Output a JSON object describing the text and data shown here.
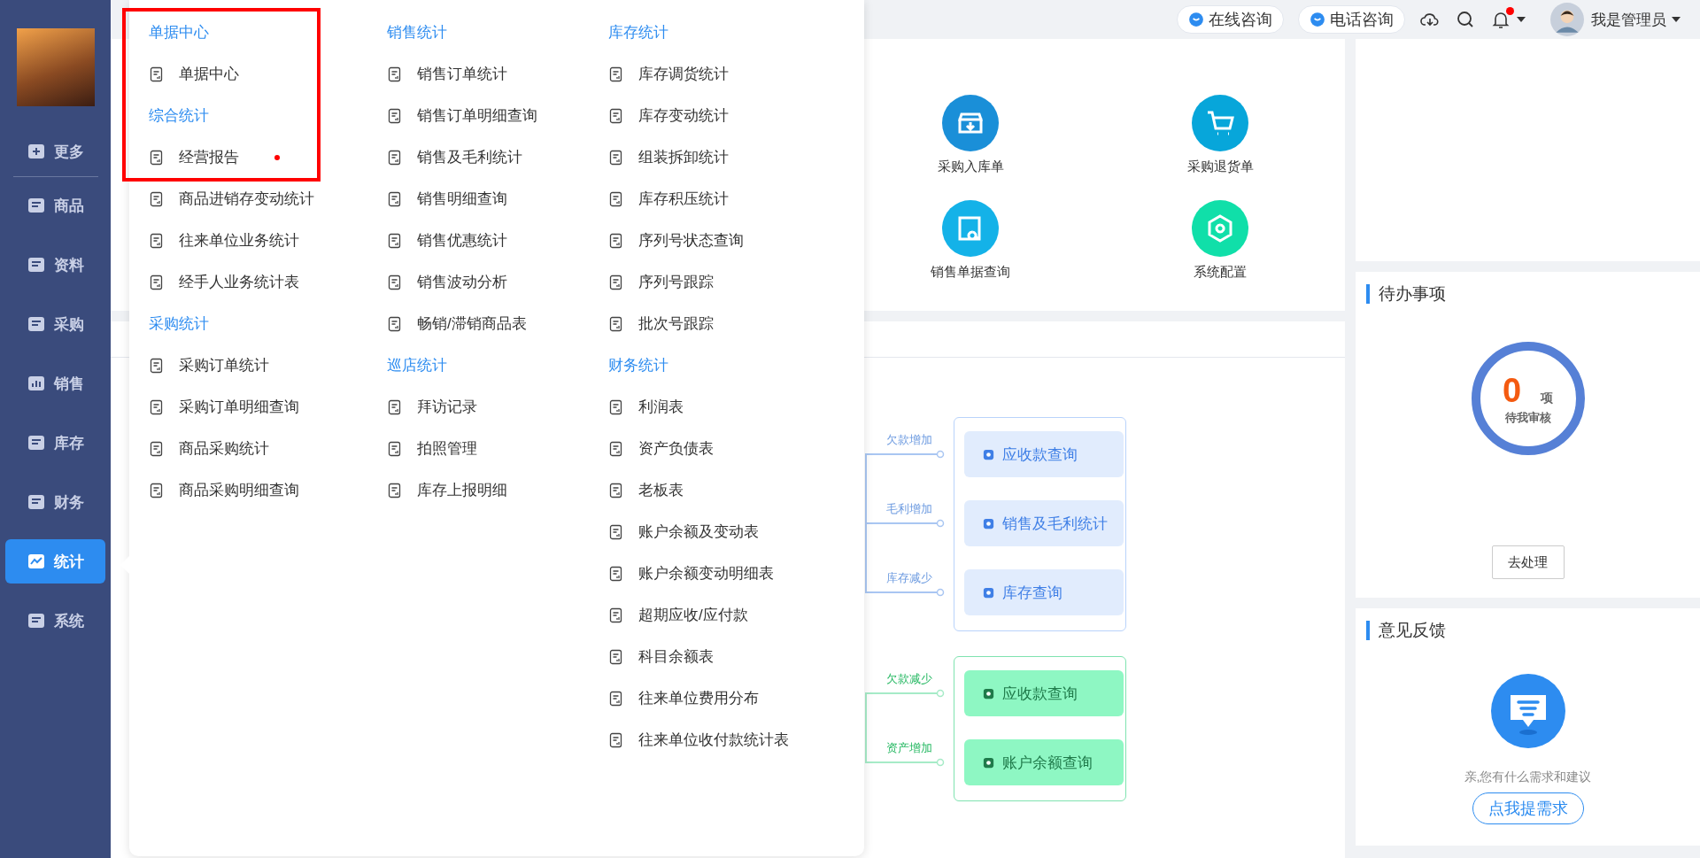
{
  "sidebar": {
    "items": [
      {
        "label": "更多",
        "selected": false
      },
      {
        "label": "商品",
        "selected": false
      },
      {
        "label": "资料",
        "selected": false
      },
      {
        "label": "采购",
        "selected": false
      },
      {
        "label": "销售",
        "selected": false
      },
      {
        "label": "库存",
        "selected": false
      },
      {
        "label": "财务",
        "selected": false
      },
      {
        "label": "统计",
        "selected": true
      },
      {
        "label": "系统",
        "selected": false
      }
    ]
  },
  "top_bar": {
    "consult_buttons": [
      "在线咨询",
      "电话咨询"
    ],
    "notifications_unread": true,
    "user_name": "我是管理员"
  },
  "quick_actions": [
    {
      "label": "采购入库单",
      "color": "#1a8fd8"
    },
    {
      "label": "采购退货单",
      "color": "#07a6da"
    },
    {
      "label": "销售单据查询",
      "color": "#14b2e8"
    },
    {
      "label": "系统配置",
      "color": "#10dfa9"
    }
  ],
  "flow": {
    "groups": [
      {
        "kind": "primary",
        "links": [
          {
            "label": "欠款增加",
            "target": "应收款查询"
          },
          {
            "label": "毛利增加",
            "target": "销售及毛利统计"
          },
          {
            "label": "库存减少",
            "target": "库存查询"
          }
        ]
      },
      {
        "kind": "success",
        "links": [
          {
            "label": "欠款减少",
            "target": "应收款查询"
          },
          {
            "label": "资产增加",
            "target": "账户余额查询"
          }
        ]
      }
    ]
  },
  "todo": {
    "title": "待办事项",
    "count": "0",
    "unit": "项",
    "caption": "待我审核",
    "button": "去处理"
  },
  "feedback": {
    "title": "意见反馈",
    "text": "亲,您有什么需求和建议",
    "button": "点我提需求"
  },
  "menu": {
    "columns": [
      {
        "rows": [
          {
            "kind": "header",
            "label": "单据中心",
            "highlighted": true,
            "dot": false
          },
          {
            "kind": "item",
            "label": "单据中心",
            "highlighted": true,
            "dot": false
          },
          {
            "kind": "header",
            "label": "综合统计",
            "highlighted": true,
            "dot": false
          },
          {
            "kind": "item",
            "label": "经营报告",
            "highlighted": true,
            "dot": true
          },
          {
            "kind": "item",
            "label": "商品进销存变动统计",
            "highlighted": false,
            "dot": false
          },
          {
            "kind": "item",
            "label": "往来单位业务统计",
            "highlighted": false,
            "dot": false
          },
          {
            "kind": "item",
            "label": "经手人业务统计表",
            "highlighted": false,
            "dot": false
          },
          {
            "kind": "header",
            "label": "采购统计",
            "highlighted": false,
            "dot": false
          },
          {
            "kind": "item",
            "label": "采购订单统计",
            "highlighted": false,
            "dot": false
          },
          {
            "kind": "item",
            "label": "采购订单明细查询",
            "highlighted": false,
            "dot": false
          },
          {
            "kind": "item",
            "label": "商品采购统计",
            "highlighted": false,
            "dot": false
          },
          {
            "kind": "item",
            "label": "商品采购明细查询",
            "highlighted": false,
            "dot": false
          }
        ]
      },
      {
        "rows": [
          {
            "kind": "header",
            "label": "销售统计",
            "highlighted": false,
            "dot": false
          },
          {
            "kind": "item",
            "label": "销售订单统计",
            "highlighted": false,
            "dot": false
          },
          {
            "kind": "item",
            "label": "销售订单明细查询",
            "highlighted": false,
            "dot": false
          },
          {
            "kind": "item",
            "label": "销售及毛利统计",
            "highlighted": false,
            "dot": false
          },
          {
            "kind": "item",
            "label": "销售明细查询",
            "highlighted": false,
            "dot": false
          },
          {
            "kind": "item",
            "label": "销售优惠统计",
            "highlighted": false,
            "dot": false
          },
          {
            "kind": "item",
            "label": "销售波动分析",
            "highlighted": false,
            "dot": false
          },
          {
            "kind": "item",
            "label": "畅销/滞销商品表",
            "highlighted": false,
            "dot": false
          },
          {
            "kind": "header",
            "label": "巡店统计",
            "highlighted": false,
            "dot": false
          },
          {
            "kind": "item",
            "label": "拜访记录",
            "highlighted": false,
            "dot": false
          },
          {
            "kind": "item",
            "label": "拍照管理",
            "highlighted": false,
            "dot": false
          },
          {
            "kind": "item",
            "label": "库存上报明细",
            "highlighted": false,
            "dot": false
          }
        ]
      },
      {
        "rows": [
          {
            "kind": "header",
            "label": "库存统计",
            "highlighted": false,
            "dot": false
          },
          {
            "kind": "item",
            "label": "库存调货统计",
            "highlighted": false,
            "dot": false
          },
          {
            "kind": "item",
            "label": "库存变动统计",
            "highlighted": false,
            "dot": false
          },
          {
            "kind": "item",
            "label": "组装拆卸统计",
            "highlighted": false,
            "dot": false
          },
          {
            "kind": "item",
            "label": "库存积压统计",
            "highlighted": false,
            "dot": false
          },
          {
            "kind": "item",
            "label": "序列号状态查询",
            "highlighted": false,
            "dot": false
          },
          {
            "kind": "item",
            "label": "序列号跟踪",
            "highlighted": false,
            "dot": false
          },
          {
            "kind": "item",
            "label": "批次号跟踪",
            "highlighted": false,
            "dot": false
          },
          {
            "kind": "header",
            "label": "财务统计",
            "highlighted": false,
            "dot": false
          },
          {
            "kind": "item",
            "label": "利润表",
            "highlighted": false,
            "dot": false
          },
          {
            "kind": "item",
            "label": "资产负债表",
            "highlighted": false,
            "dot": false
          },
          {
            "kind": "item",
            "label": "老板表",
            "highlighted": false,
            "dot": false
          },
          {
            "kind": "item",
            "label": "账户余额及变动表",
            "highlighted": false,
            "dot": false
          },
          {
            "kind": "item",
            "label": "账户余额变动明细表",
            "highlighted": false,
            "dot": false
          },
          {
            "kind": "item",
            "label": "超期应收/应付款",
            "highlighted": false,
            "dot": false
          },
          {
            "kind": "item",
            "label": "科目余额表",
            "highlighted": false,
            "dot": false
          },
          {
            "kind": "item",
            "label": "往来单位费用分布",
            "highlighted": false,
            "dot": false
          },
          {
            "kind": "item",
            "label": "往来单位收付款统计表",
            "highlighted": false,
            "dot": false
          }
        ]
      }
    ]
  }
}
